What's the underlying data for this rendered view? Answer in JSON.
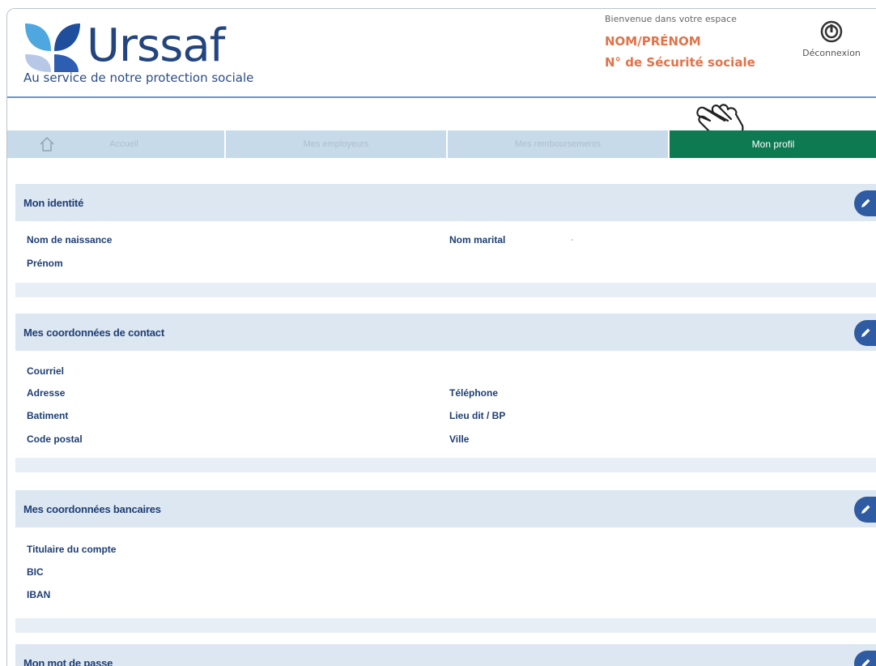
{
  "header": {
    "brand_name": "Urssaf",
    "tagline": "Au service de notre protection sociale",
    "welcome": "Bienvenue dans votre espace",
    "user_name": "NOM/PRÉNOM",
    "user_ssn": "N° de Sécurité sociale",
    "logout_label": "Déconnexion"
  },
  "tabs": [
    {
      "label": "Accueil",
      "active": false
    },
    {
      "label": "Mes employeurs",
      "active": false
    },
    {
      "label": "Mes remboursements",
      "active": false
    },
    {
      "label": "Mon profil",
      "active": true
    }
  ],
  "sections": {
    "identity": {
      "title": "Mon identité",
      "fields": {
        "birth_name": "Nom de naissance",
        "marital_name": "Nom marital",
        "marital_value": "-",
        "first_name": "Prénom"
      }
    },
    "contact": {
      "title": "Mes coordonnées de contact",
      "fields": {
        "email": "Courriel",
        "address": "Adresse",
        "phone": "Téléphone",
        "building": "Batiment",
        "locality": "Lieu dit / BP",
        "postal_code": "Code postal",
        "city": "Ville"
      }
    },
    "bank": {
      "title": "Mes coordonnées bancaires",
      "fields": {
        "holder": "Titulaire du compte",
        "bic": "BIC",
        "iban": "IBAN"
      }
    },
    "password": {
      "title": "Mon mot de passe"
    }
  },
  "colors": {
    "brand_blue": "#23457f",
    "accent_orange": "#e0734a",
    "active_tab_green": "#0e7a52",
    "tab_inactive": "#c6daea",
    "section_header": "#dde7f2",
    "edit_button": "#2f5ba3"
  },
  "icons": {
    "logout": "power-icon",
    "home": "home-icon",
    "edit": "pencil-icon",
    "cursor": "pointing-hand-icon"
  }
}
